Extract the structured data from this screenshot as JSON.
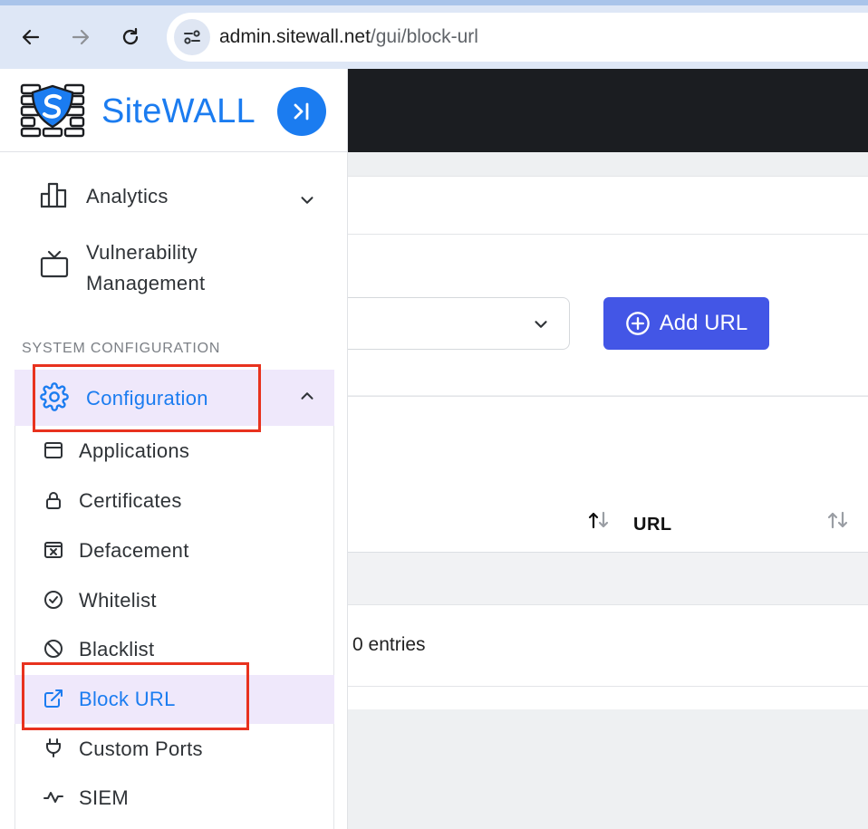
{
  "browser": {
    "url_host": "admin.sitewall.net",
    "url_path": "/gui/block-url"
  },
  "brand": {
    "name": "SiteWALL"
  },
  "sidebar": {
    "items": [
      {
        "label": "Analytics"
      },
      {
        "label_line1": "Vulnerability",
        "label_line2": "Management"
      }
    ],
    "section_title": "SYSTEM CONFIGURATION",
    "config": {
      "label": "Configuration"
    },
    "sub_items": [
      {
        "label": "Applications",
        "icon": "window-icon"
      },
      {
        "label": "Certificates",
        "icon": "lock-icon"
      },
      {
        "label": "Defacement",
        "icon": "x-box-icon"
      },
      {
        "label": "Whitelist",
        "icon": "check-circle-icon"
      },
      {
        "label": "Blacklist",
        "icon": "ban-icon"
      },
      {
        "label": "Block URL",
        "icon": "external-link-icon"
      },
      {
        "label": "Custom Ports",
        "icon": "plug-icon"
      },
      {
        "label": "SIEM",
        "icon": "activity-icon"
      }
    ]
  },
  "main": {
    "add_button_label": "Add URL",
    "table": {
      "column_url": "URL"
    },
    "entries_text": "0 entries"
  },
  "colors": {
    "brand_blue": "#1b7cf0",
    "add_button": "#4356e6",
    "active_bg": "#efe8fb",
    "highlight_red": "#e8321e",
    "header_dark": "#1b1d21"
  }
}
